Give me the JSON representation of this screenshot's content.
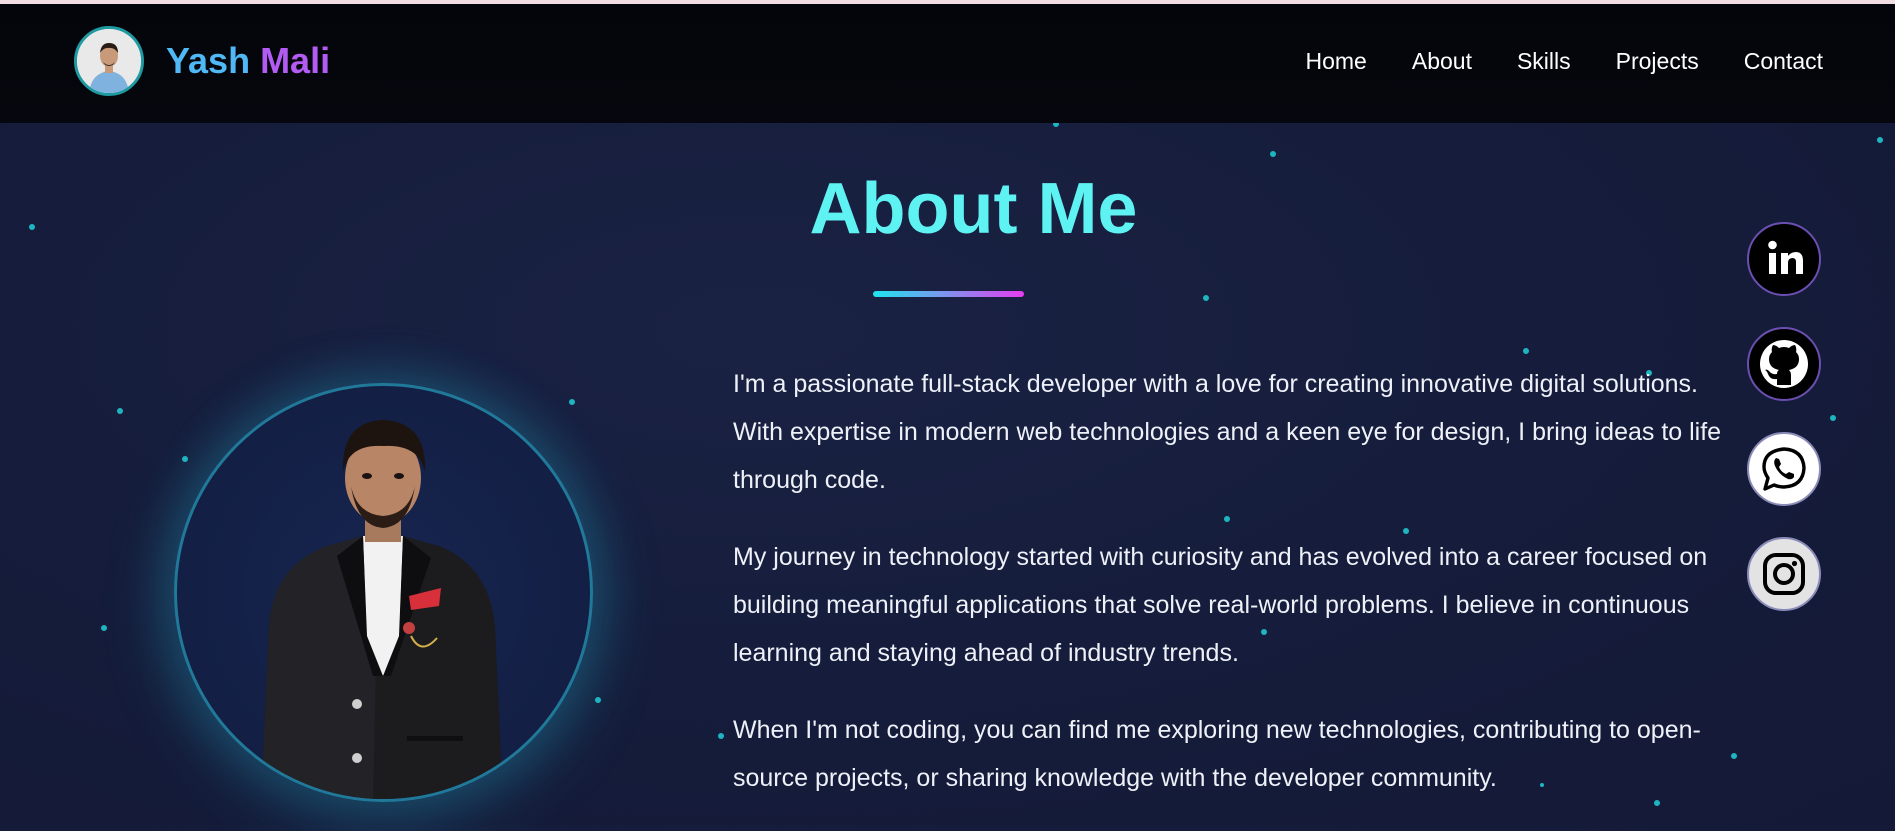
{
  "brand": {
    "first_name": "Yash",
    "last_name": "Mali"
  },
  "nav": {
    "items": [
      {
        "label": "Home"
      },
      {
        "label": "About"
      },
      {
        "label": "Skills"
      },
      {
        "label": "Projects"
      },
      {
        "label": "Contact"
      }
    ]
  },
  "about": {
    "title": "About Me",
    "paragraphs": [
      "I'm a passionate full-stack developer with a love for creating innovative digital solutions. With expertise in modern web technologies and a keen eye for design, I bring ideas to life through code.",
      "My journey in technology started with curiosity and has evolved into a career focused on building meaningful applications that solve real-world problems. I believe in continuous learning and staying ahead of industry trends.",
      "When I'm not coding, you can find me exploring new technologies, contributing to open-source projects, or sharing knowledge with the developer community."
    ]
  },
  "social": [
    {
      "icon": "linkedin-icon"
    },
    {
      "icon": "github-icon"
    },
    {
      "icon": "whatsapp-icon"
    },
    {
      "icon": "instagram-icon"
    }
  ],
  "colors": {
    "title_accent": "#5ef2f2",
    "brand_first": "#4fb8f5",
    "brand_last": "#b35cf3",
    "underline_start": "#1ee4ef",
    "underline_end": "#e63cef",
    "background": "#161d3c",
    "navbar": "#05060c"
  }
}
